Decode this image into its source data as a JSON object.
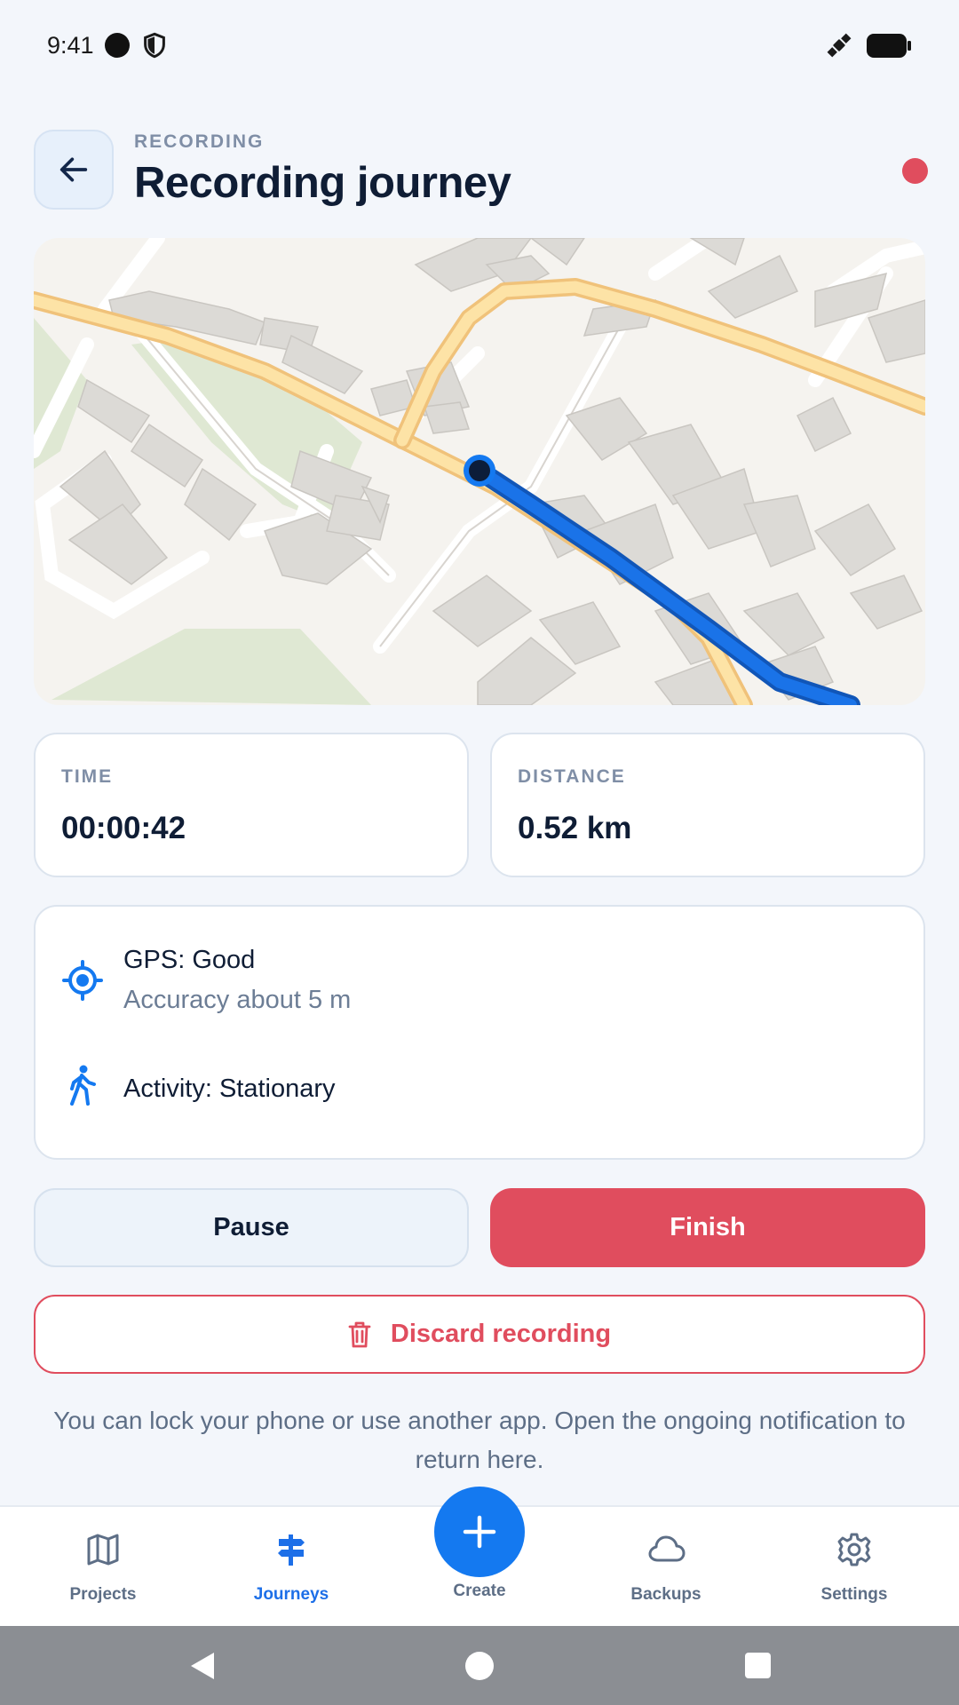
{
  "status_bar": {
    "time": "9:41",
    "icons": [
      "camera-dot-icon",
      "shield-icon",
      "satellite-icon",
      "battery-icon"
    ]
  },
  "header": {
    "eyebrow": "RECORDING",
    "title": "Recording journey",
    "back_icon": "arrow-left-icon",
    "recording_indicator_color": "#e04d5e"
  },
  "map": {
    "route_color": "#1a73e8",
    "current_position_icon": "location-dot-icon"
  },
  "stats": {
    "time": {
      "label": "TIME",
      "value": "00:00:42"
    },
    "distance": {
      "label": "DISTANCE",
      "value": "0.52 km"
    }
  },
  "status_info": {
    "gps_title": "GPS: Good",
    "gps_subtitle": "Accuracy about 5 m",
    "activity": "Activity: Stationary",
    "gps_icon": "gps-crosshair-icon",
    "activity_icon": "walking-person-icon"
  },
  "actions": {
    "pause_label": "Pause",
    "finish_label": "Finish",
    "discard_label": "Discard recording",
    "discard_icon": "trash-icon"
  },
  "hint": "You can lock your phone or use another app. Open the ongoing notification to return here.",
  "bottom_nav": {
    "items": [
      {
        "label": "Projects",
        "icon": "map-icon",
        "active": false
      },
      {
        "label": "Journeys",
        "icon": "signpost-icon",
        "active": true
      },
      {
        "label": "Create",
        "icon": "plus-icon",
        "active": false
      },
      {
        "label": "Backups",
        "icon": "cloud-icon",
        "active": false
      },
      {
        "label": "Settings",
        "icon": "gear-icon",
        "active": false
      }
    ]
  },
  "colors": {
    "accent": "#1479f0",
    "danger": "#e04d5e",
    "text_primary": "#0f1d35",
    "text_secondary": "#6c7d95",
    "background": "#f3f6fb"
  }
}
